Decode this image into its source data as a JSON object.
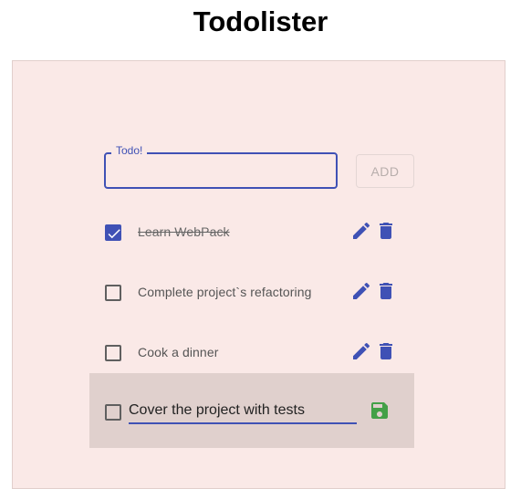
{
  "app": {
    "title": "Todolister"
  },
  "form": {
    "label": "Todo!",
    "value": "",
    "add_label": "ADD"
  },
  "todos": [
    {
      "text": "Learn WebPack",
      "done": true
    },
    {
      "text": "Complete project`s refactoring",
      "done": false
    },
    {
      "text": "Cook a dinner",
      "done": false
    }
  ],
  "editing": {
    "value": "Cover the project with tests",
    "done": false
  },
  "icons": {
    "edit": "pencil-icon",
    "delete": "trash-icon",
    "save": "save-icon",
    "check": "check-icon"
  },
  "colors": {
    "accent": "#3f51b5",
    "save": "#43a047",
    "panel": "#fae9e7"
  }
}
